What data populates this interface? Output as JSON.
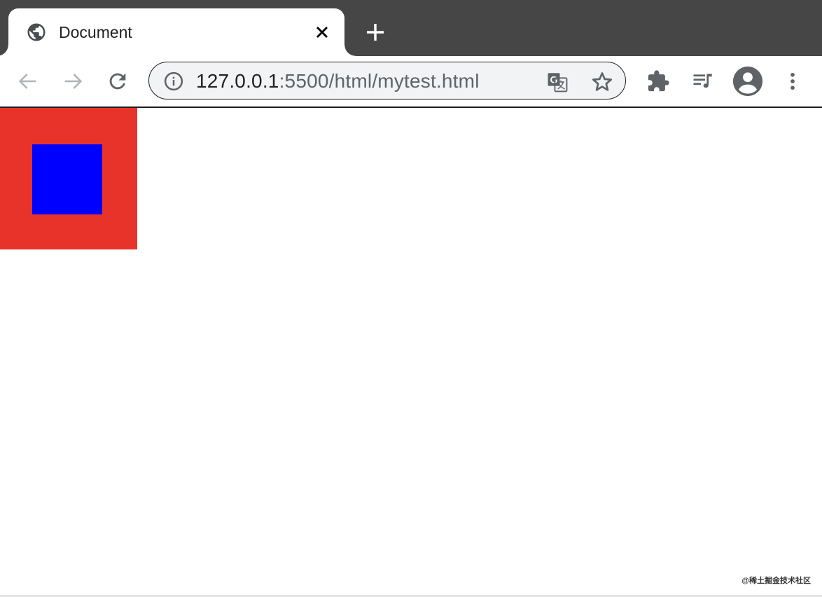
{
  "tab": {
    "title": "Document",
    "favicon_icon": "globe-icon",
    "close_icon": "close-icon"
  },
  "new_tab": {
    "icon": "plus-icon"
  },
  "toolbar": {
    "back_icon": "arrow-left-icon",
    "forward_icon": "arrow-right-icon",
    "reload_icon": "reload-icon",
    "extensions_icon": "puzzle-icon",
    "media_icon": "queue-music-icon",
    "profile_icon": "account-circle-icon",
    "menu_icon": "more-vert-icon"
  },
  "omnibox": {
    "url_host": "127.0.0.1",
    "url_path": ":5500/html/mytest.html",
    "info_icon": "info-icon",
    "translate_icon": "translate-icon",
    "bookmark_icon": "star-icon"
  },
  "page": {
    "outer_color": "#e8332a",
    "inner_color": "#0000ff"
  },
  "watermark": "@稀土掘金技术社区",
  "colors": {
    "tabstrip": "#464646",
    "omnibox_bg": "#f1f3f4"
  }
}
